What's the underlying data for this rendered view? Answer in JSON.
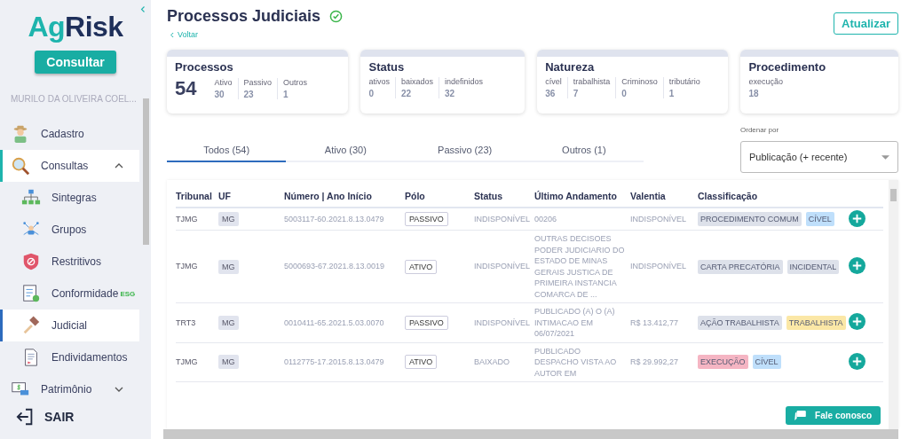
{
  "sidebar": {
    "logo": {
      "part1": "Ag",
      "part2": "Risk"
    },
    "consult_button": "Consultar",
    "user": "MURILO DA OLIVEIRA COEL...",
    "items": [
      {
        "label": "Cadastro",
        "kind": "farmer",
        "selected": false
      },
      {
        "label": "Consultas",
        "kind": "search",
        "selected": true,
        "expanded": true,
        "children": [
          {
            "label": "Sintegras",
            "kind": "network",
            "selected": false
          },
          {
            "label": "Grupos",
            "kind": "group",
            "selected": false
          },
          {
            "label": "Restritivos",
            "kind": "shield",
            "selected": false
          },
          {
            "label": "Conformidade",
            "kind": "checklist",
            "badge": "ESG",
            "selected": false
          },
          {
            "label": "Judicial",
            "kind": "gavel",
            "selected": true
          },
          {
            "label": "Endividamentos",
            "kind": "document",
            "selected": false
          }
        ]
      },
      {
        "label": "Patrimônio",
        "kind": "money",
        "selected": false,
        "expanded": false
      }
    ],
    "logout": "SAIR"
  },
  "header": {
    "title": "Processos Judiciais",
    "verified": true,
    "back": "Voltar",
    "refresh_button": "Atualizar"
  },
  "cards": [
    {
      "title": "Processos",
      "total": "54",
      "stats": [
        {
          "label": "Ativo",
          "value": "30"
        },
        {
          "label": "Passivo",
          "value": "23"
        },
        {
          "label": "Outros",
          "value": "1"
        }
      ]
    },
    {
      "title": "Status",
      "stats": [
        {
          "label": "ativos",
          "value": "0"
        },
        {
          "label": "baixados",
          "value": "22"
        },
        {
          "label": "indefinidos",
          "value": "32"
        }
      ]
    },
    {
      "title": "Natureza",
      "stats": [
        {
          "label": "cível",
          "value": "36"
        },
        {
          "label": "trabalhista",
          "value": "7"
        },
        {
          "label": "Criminoso",
          "value": "0"
        },
        {
          "label": "tributário",
          "value": "1"
        }
      ]
    },
    {
      "title": "Procedimento",
      "stats": [
        {
          "label": "execução",
          "value": "18"
        }
      ]
    }
  ],
  "tabs": [
    {
      "label": "Todos (54)",
      "selected": true
    },
    {
      "label": "Ativo (30)",
      "selected": false
    },
    {
      "label": "Passivo (23)",
      "selected": false
    },
    {
      "label": "Outros (1)",
      "selected": false
    }
  ],
  "sort": {
    "label": "Ordenar por",
    "value": "Publicação (+ recente)"
  },
  "table": {
    "columns": [
      "Tribunal",
      "UF",
      "Número | Ano Início",
      "Pólo",
      "Status",
      "Último Andamento",
      "Valentia",
      "Classificação"
    ],
    "rows": [
      {
        "tribunal": "TJMG",
        "uf": "MG",
        "numero": "5003117-60.2021.8.13.0479",
        "polo": "PASSIVO",
        "status": "INDISPONÍVEL",
        "andamento": "00206",
        "valentia": "INDISPONÍVEL",
        "tags": [
          {
            "label": "PROCEDIMENTO COMUM",
            "color": "#dde1ea"
          },
          {
            "label": "CÍVEL",
            "color": "#bfdffb"
          }
        ]
      },
      {
        "tribunal": "TJMG",
        "uf": "MG",
        "numero": "5000693-67.2021.8.13.0019",
        "polo": "ATIVO",
        "status": "INDISPONÍVEL",
        "andamento": "OUTRAS DECISOES PODER JUDICIARIO DO ESTADO DE MINAS GERAIS JUSTICA DE PRIMEIRA INSTANCIA COMARCA DE ...",
        "valentia": "INDISPONÍVEL",
        "tags": [
          {
            "label": "CARTA PRECATÓRIA",
            "color": "#dde1ea"
          },
          {
            "label": "INCIDENTAL",
            "color": "#dde1ea"
          }
        ]
      },
      {
        "tribunal": "TRT3",
        "uf": "MG",
        "numero": "0010411-65.2021.5.03.0070",
        "polo": "PASSIVO",
        "status": "INDISPONÍVEL",
        "andamento": "PUBLICADO (A) O (A) INTIMACAO EM 06/07/2021",
        "valentia": "R$ 13.412,77",
        "tags": [
          {
            "label": "AÇÃO TRABALHISTA",
            "color": "#dde1ea"
          },
          {
            "label": "TRABALHISTA",
            "color": "#fbe7a6"
          }
        ]
      },
      {
        "tribunal": "TJMG",
        "uf": "MG",
        "numero": "0112775-17.2015.8.13.0479",
        "polo": "ATIVO",
        "status": "BAIXADO",
        "andamento": "PUBLICADO DESPACHO VISTA AO AUTOR EM",
        "valentia": "R$ 29.992,27",
        "tags": [
          {
            "label": "EXECUÇÃO",
            "color": "#f5b5c3"
          },
          {
            "label": "CÍVEL",
            "color": "#bfdffb"
          }
        ]
      }
    ]
  },
  "chat_button": "Fale conosco"
}
